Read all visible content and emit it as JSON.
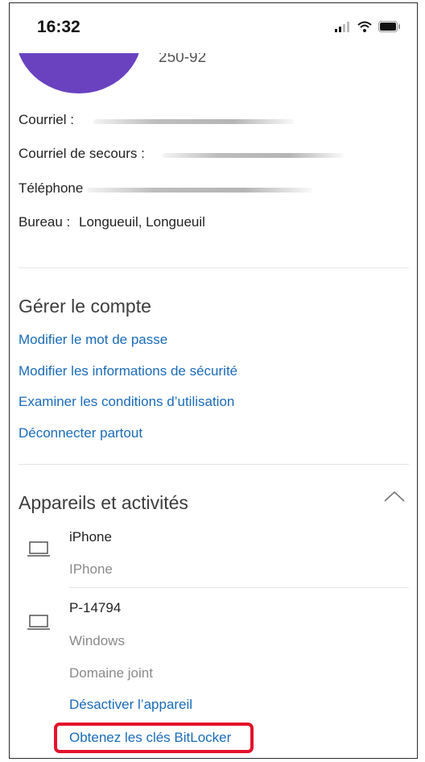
{
  "status_bar": {
    "time": "16:32"
  },
  "profile": {
    "partial_id": "250-92",
    "email_label": "Courriel :",
    "backup_email_label": "Courriel de secours :",
    "phone_label": "Téléphone",
    "office_label": "Bureau :",
    "office_value": "Longueuil, Longueuil"
  },
  "manage_account": {
    "title": "Gérer le compte",
    "links": [
      "Modifier le mot de passe",
      "Modifier les informations de sécurité",
      "Examiner les conditions d’utilisation",
      "Déconnecter partout"
    ]
  },
  "devices": {
    "title": "Appareils et activités",
    "items": [
      {
        "name": "iPhone",
        "meta": [
          "IPhone"
        ]
      },
      {
        "name": "P-14794",
        "meta": [
          "Windows",
          "Domaine joint"
        ],
        "actions": [
          "Désactiver l’appareil",
          "Obtenez les clés BitLocker"
        ]
      }
    ]
  },
  "colors": {
    "avatar": "#6a42c0",
    "link": "#1a6bb8",
    "highlight": "#e4132a"
  },
  "icons": [
    "signal-icon",
    "wifi-icon",
    "battery-icon",
    "chevron-up-icon",
    "laptop-icon"
  ]
}
